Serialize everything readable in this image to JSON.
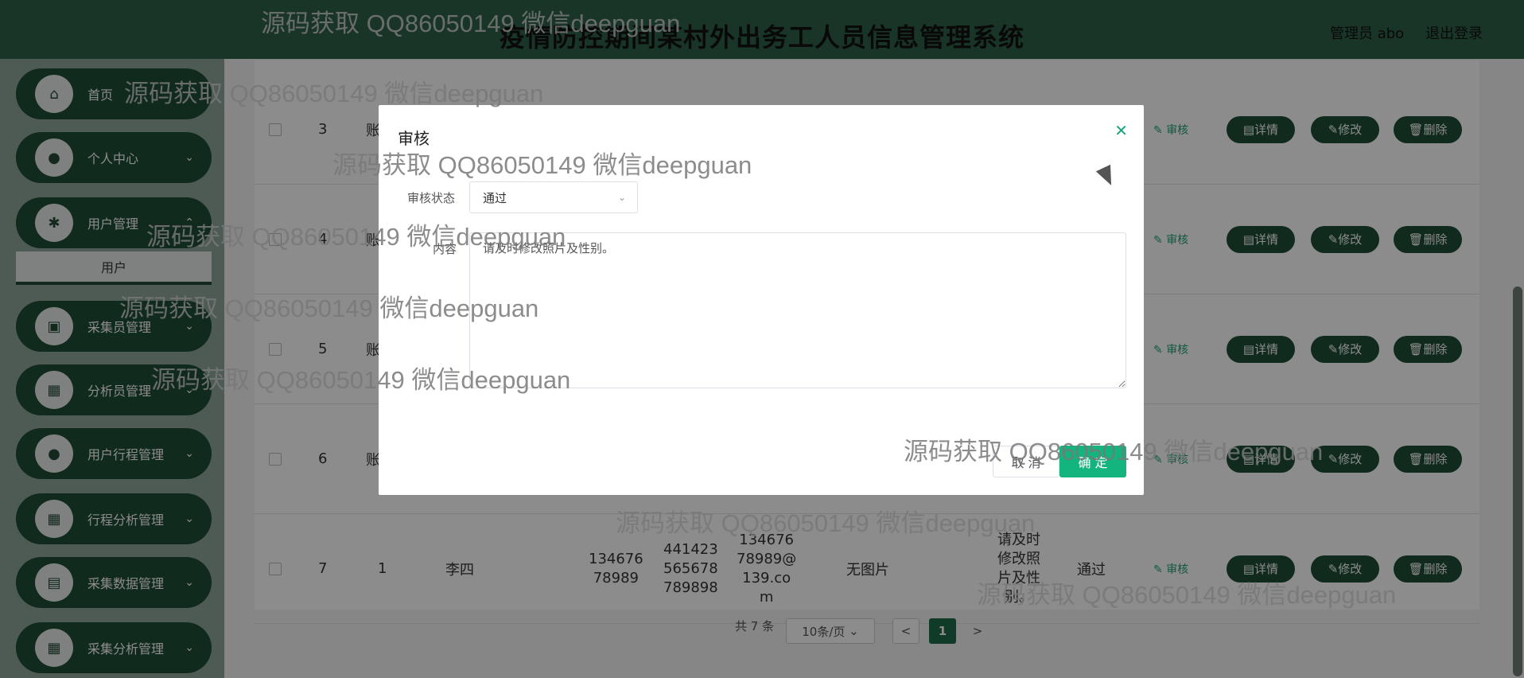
{
  "app": {
    "title": "疫情防控期间某村外出务工人员信息管理系统",
    "user_label": "管理员 abo",
    "logout_label": "退出登录"
  },
  "sidebar": {
    "items": [
      {
        "label": "首页",
        "icon": "home-icon"
      },
      {
        "label": "个人中心",
        "icon": "user-icon"
      },
      {
        "label": "用户管理",
        "icon": "users-icon"
      },
      {
        "label": "采集员管理",
        "icon": "chart-icon"
      },
      {
        "label": "分析员管理",
        "icon": "grid-icon"
      },
      {
        "label": "用户行程管理",
        "icon": "user-icon"
      },
      {
        "label": "行程分析管理",
        "icon": "grid-icon"
      },
      {
        "label": "采集数据管理",
        "icon": "clipboard-icon"
      },
      {
        "label": "采集分析管理",
        "icon": "grid-icon"
      }
    ],
    "submenu_user": "用户"
  },
  "table": {
    "rows": [
      {
        "index": "3",
        "account": "账"
      },
      {
        "index": "4",
        "account": "账"
      },
      {
        "index": "5",
        "account": "账"
      },
      {
        "index": "6",
        "account": "账"
      },
      {
        "index": "7",
        "account": "1",
        "name": "李四",
        "phone": "13467678989",
        "idcard": "441423565678789898",
        "email": "13467678989@139.com",
        "photo": "无图片",
        "reply": "请及时修改照片及性别。",
        "status": "通过"
      }
    ],
    "row7": {
      "phone_l1": "134676",
      "phone_l2": "78989",
      "id_l1": "441423",
      "id_l2": "565678",
      "id_l3": "789898",
      "email_l1": "134676",
      "email_l2": "78989@",
      "email_l3": "139.co",
      "email_l4": "m",
      "reply_l1": "请及时",
      "reply_l2": "修改照",
      "reply_l3": "片及性",
      "reply_l4": "别。"
    },
    "actions": {
      "audit": "审核",
      "detail": "详情",
      "edit": "修改",
      "delete": "删除"
    }
  },
  "pagination": {
    "total": "共 7 条",
    "page_size": "10条/页",
    "prev": "<",
    "next": ">",
    "current_page": "1"
  },
  "modal": {
    "title": "审核",
    "status_label": "审核状态",
    "status_value": "通过",
    "content_label": "内容",
    "content_value": "请及时修改照片及性别。",
    "cancel_label": "取 消",
    "ok_label": "确 定"
  },
  "watermark": "源码获取 QQ86050149 微信deepguan",
  "colors": {
    "primary": "#1e4d35",
    "accent": "#13b47e",
    "header": "#2f6249"
  }
}
